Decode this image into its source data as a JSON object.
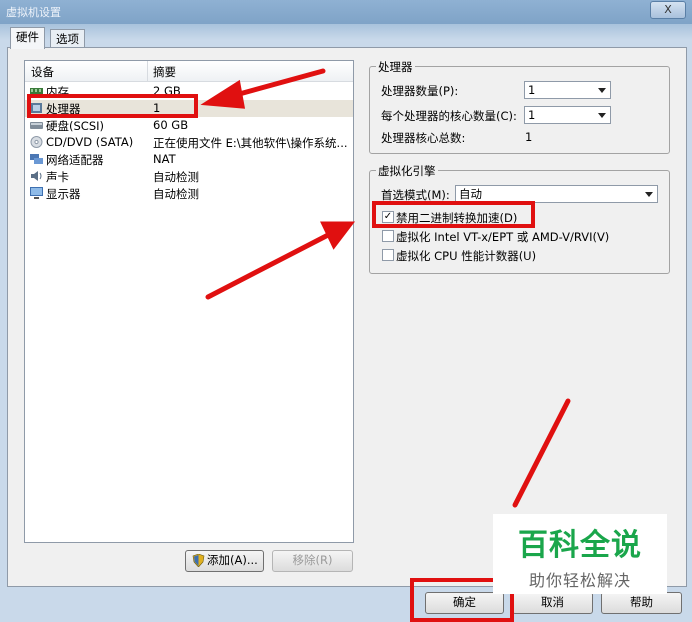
{
  "window": {
    "title": "虚拟机设置",
    "close_glyph": "X"
  },
  "tabs": [
    {
      "label": "硬件"
    },
    {
      "label": "选项"
    }
  ],
  "device_list": {
    "columns": [
      "设备",
      "摘要"
    ],
    "rows": [
      {
        "name": "内存",
        "summary": "2 GB",
        "icon": "memory-icon"
      },
      {
        "name": "处理器",
        "summary": "1",
        "icon": "processor-icon"
      },
      {
        "name": "硬盘(SCSI)",
        "summary": "60 GB",
        "icon": "hard-disk-icon"
      },
      {
        "name": "CD/DVD (SATA)",
        "summary": "正在使用文件 E:\\其他软件\\操作系统...",
        "icon": "cd-dvd-icon"
      },
      {
        "name": "网络适配器",
        "summary": "NAT",
        "icon": "network-adapter-icon"
      },
      {
        "name": "声卡",
        "summary": "自动检测",
        "icon": "sound-card-icon"
      },
      {
        "name": "显示器",
        "summary": "自动检测",
        "icon": "display-icon"
      }
    ],
    "selected_index": 1
  },
  "list_buttons": {
    "add": "添加(A)...",
    "remove": "移除(R)"
  },
  "processor": {
    "group_title": "处理器",
    "count_label": "处理器数量(P):",
    "count_value": "1",
    "cores_label": "每个处理器的核心数量(C):",
    "cores_value": "1",
    "total_label": "处理器核心总数:",
    "total_value": "1"
  },
  "virtualization": {
    "group_title": "虚拟化引擎",
    "mode_label": "首选模式(M):",
    "mode_value": "自动",
    "options": [
      {
        "label": "禁用二进制转换加速(D)",
        "checked": true
      },
      {
        "label": "虚拟化 Intel VT-x/EPT 或 AMD-V/RVI(V)",
        "checked": false
      },
      {
        "label": "虚拟化 CPU 性能计数器(U)",
        "checked": false
      }
    ]
  },
  "dialog_buttons": {
    "ok": "确定",
    "cancel": "取消",
    "help": "帮助"
  },
  "watermark": {
    "title": "百科全说",
    "subtitle": "助你轻松解决"
  },
  "colors": {
    "annotation_red": "#e01010",
    "watermark_green": "#1aa64b"
  }
}
